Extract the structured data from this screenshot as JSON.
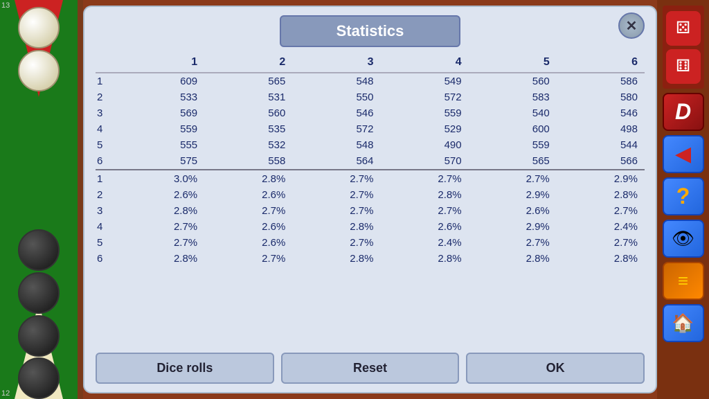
{
  "title": "Statistics",
  "close_label": "✕",
  "table": {
    "columns": [
      "",
      "1",
      "2",
      "3",
      "4",
      "5",
      "6"
    ],
    "count_rows": [
      [
        "1",
        "609",
        "565",
        "548",
        "549",
        "560",
        "586"
      ],
      [
        "2",
        "533",
        "531",
        "550",
        "572",
        "583",
        "580"
      ],
      [
        "3",
        "569",
        "560",
        "546",
        "559",
        "540",
        "546"
      ],
      [
        "4",
        "559",
        "535",
        "572",
        "529",
        "600",
        "498"
      ],
      [
        "5",
        "555",
        "532",
        "548",
        "490",
        "559",
        "544"
      ],
      [
        "6",
        "575",
        "558",
        "564",
        "570",
        "565",
        "566"
      ]
    ],
    "pct_rows": [
      [
        "1",
        "3.0%",
        "2.8%",
        "2.7%",
        "2.7%",
        "2.7%",
        "2.9%"
      ],
      [
        "2",
        "2.6%",
        "2.6%",
        "2.7%",
        "2.8%",
        "2.9%",
        "2.8%"
      ],
      [
        "3",
        "2.8%",
        "2.7%",
        "2.7%",
        "2.7%",
        "2.6%",
        "2.7%"
      ],
      [
        "4",
        "2.7%",
        "2.6%",
        "2.8%",
        "2.6%",
        "2.9%",
        "2.4%"
      ],
      [
        "5",
        "2.7%",
        "2.6%",
        "2.7%",
        "2.4%",
        "2.7%",
        "2.7%"
      ],
      [
        "6",
        "2.8%",
        "2.7%",
        "2.8%",
        "2.8%",
        "2.8%",
        "2.8%"
      ]
    ]
  },
  "buttons": {
    "dice_rolls": "Dice rolls",
    "reset": "Reset",
    "ok": "OK"
  },
  "sidebar": {
    "d_label": "D",
    "arrow_icon": "◀",
    "question_icon": "?",
    "eye_icon": "👁",
    "menu_icon": "≡",
    "home_icon": "🏠"
  },
  "corner_numbers": {
    "top": "13",
    "bottom": "12"
  }
}
